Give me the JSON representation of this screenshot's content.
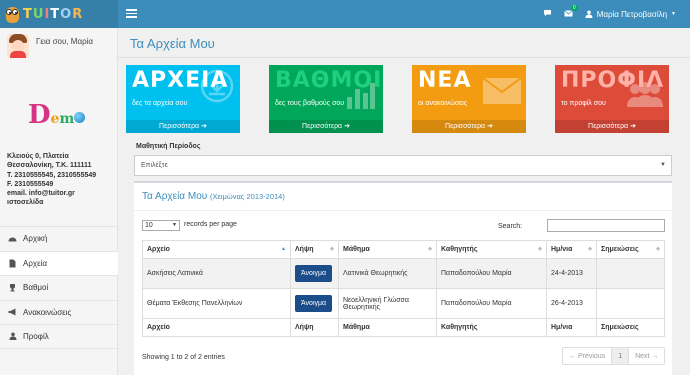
{
  "header": {
    "brand_letters": [
      "T",
      "U",
      "I",
      "T",
      "O",
      "R"
    ],
    "user_name": "Μαρία Πετροβασίλη",
    "messages_badge": "0"
  },
  "sidebar": {
    "greeting": "Γεια σου, Μαρία",
    "school_logo": "Demo",
    "contact_lines": [
      "Κλειούς 0, Πλατεία",
      "Θεσσαλονίκη, Τ.Κ. 111111",
      "Τ. 2310555545, 2310555549",
      "F. 2310555549",
      "email. info@tuitor.gr",
      "ιστοσελίδα"
    ],
    "nav": [
      {
        "label": "Αρχική",
        "icon": "dashboard-icon"
      },
      {
        "label": "Αρχεία",
        "icon": "file-icon",
        "active": true
      },
      {
        "label": "Βαθμοί",
        "icon": "trophy-icon"
      },
      {
        "label": "Ανακοινώσεις",
        "icon": "bullhorn-icon"
      },
      {
        "label": "Προφίλ",
        "icon": "user-icon"
      }
    ]
  },
  "page": {
    "title": "Τα Αρχεία Μου"
  },
  "tiles": [
    {
      "title": "ΑΡΧΕΙΑ",
      "subtitle": "δες τα αρχεία σου",
      "more": "Περισσότερα",
      "color": "#00c0ef",
      "icon": "download-icon"
    },
    {
      "title": "ΒΑΘΜΟΙ",
      "subtitle": "δες τους βαθμούς σου",
      "more": "Περισσότερα",
      "color": "#00a65a",
      "icon": "bar-chart-icon"
    },
    {
      "title": "ΝΕΑ",
      "subtitle": "οι ανακοινώσεις",
      "more": "Περισσότερα",
      "color": "#f39c12",
      "icon": "envelope-icon"
    },
    {
      "title": "ΠΡΟΦΙΛ",
      "subtitle": "το προφίλ σου",
      "more": "Περισσότερα",
      "color": "#dd4b39",
      "icon": "users-icon"
    }
  ],
  "period": {
    "label": "Μαθητική Περίοδος",
    "selected": "Επιλέξτε"
  },
  "files_box": {
    "title": "Τα Αρχεία Μου",
    "subtitle": "(Χειμώνας 2013-2014)",
    "page_length": "10",
    "page_length_label": "records per page",
    "search_label": "Search:",
    "columns": [
      "Αρχείο",
      "Λήψη",
      "Μάθημα",
      "Καθηγητής",
      "Ημ/νια",
      "Σημειώσεις"
    ],
    "rows": [
      {
        "file": "Ασκήσεις Λατινικά",
        "action": "Άνοιγμα",
        "subject": "Λατινικά Θεωρητικής",
        "teacher": "Παπαδοπούλου Μαρία",
        "date": "24-4-2013",
        "notes": ""
      },
      {
        "file": "Θέματα Έκθεσης Πανελληνίων",
        "action": "Άνοιγμα",
        "subject": "Νεοελληνική Γλώσσα Θεωρητικής",
        "teacher": "Παπαδοπούλου Μαρία",
        "date": "26-4-2013",
        "notes": ""
      }
    ],
    "info": "Showing 1 to 2 of 2 entries",
    "pager": {
      "prev": "← Previous",
      "current": "1",
      "next": "Next →"
    }
  }
}
